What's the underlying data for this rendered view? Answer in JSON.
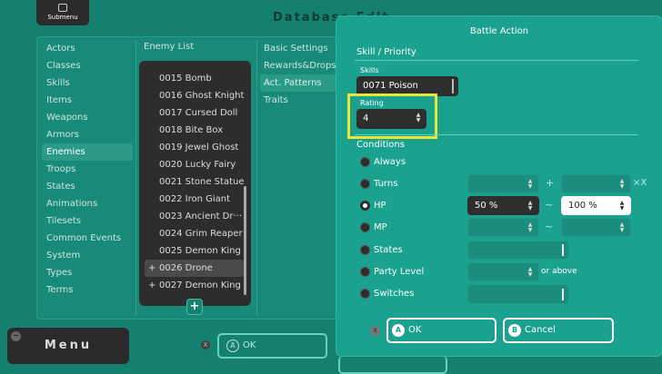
{
  "header": {
    "submenu_label": "Submenu",
    "title": "Database Edit"
  },
  "categories": [
    "Actors",
    "Classes",
    "Skills",
    "Items",
    "Weapons",
    "Armors",
    "Enemies",
    "Troops",
    "States",
    "Animations",
    "Tilesets",
    "Common Events",
    "System",
    "Types",
    "Terms"
  ],
  "selected_category": "Enemies",
  "enemy_list": {
    "title": "Enemy List",
    "items": [
      "0015 Bomb",
      "0016 Ghost Knight",
      "0017 Cursed Doll",
      "0018 Bite Box",
      "0019 Jewel Ghost",
      "0020 Lucky Fairy",
      "0021 Stone Statue",
      "0022 Iron Giant",
      "0023 Ancient Dr···",
      "0024 Grim Reaper",
      "0025 Demon King",
      "0026 Drone",
      "0027 Demon King"
    ],
    "plus_marker": "+",
    "add_label": "+"
  },
  "tabs": [
    "Basic Settings",
    "Rewards&Drops",
    "Act. Patterns",
    "Traits"
  ],
  "selected_tab": "Act. Patterns",
  "footer": {
    "menu_label": "Menu",
    "ok_label": "OK",
    "a_glyph": "A",
    "x_glyph": "X"
  },
  "dialog": {
    "title": "Battle Action",
    "section_skill": "Skill / Priority",
    "skills_label": "Skills",
    "skills_value": "0071 Poison",
    "rating_label": "Rating",
    "rating_value": "4",
    "section_conditions": "Conditions",
    "conditions": {
      "always": "Always",
      "turns": "Turns",
      "hp": "HP",
      "mp": "MP",
      "states": "States",
      "party_level": "Party Level",
      "switches": "Switches"
    },
    "selected_condition": "HP",
    "turns_plus": "+",
    "turns_suffix": "×X",
    "tilde": "~",
    "hp_min": "50 %",
    "hp_max": "100 %",
    "or_above": "or above",
    "ok_label": "OK",
    "cancel_label": "Cancel",
    "ok_glyph": "A",
    "cancel_glyph": "B",
    "x_glyph": "X",
    "spin_up": "▲",
    "spin_down": "▼"
  }
}
